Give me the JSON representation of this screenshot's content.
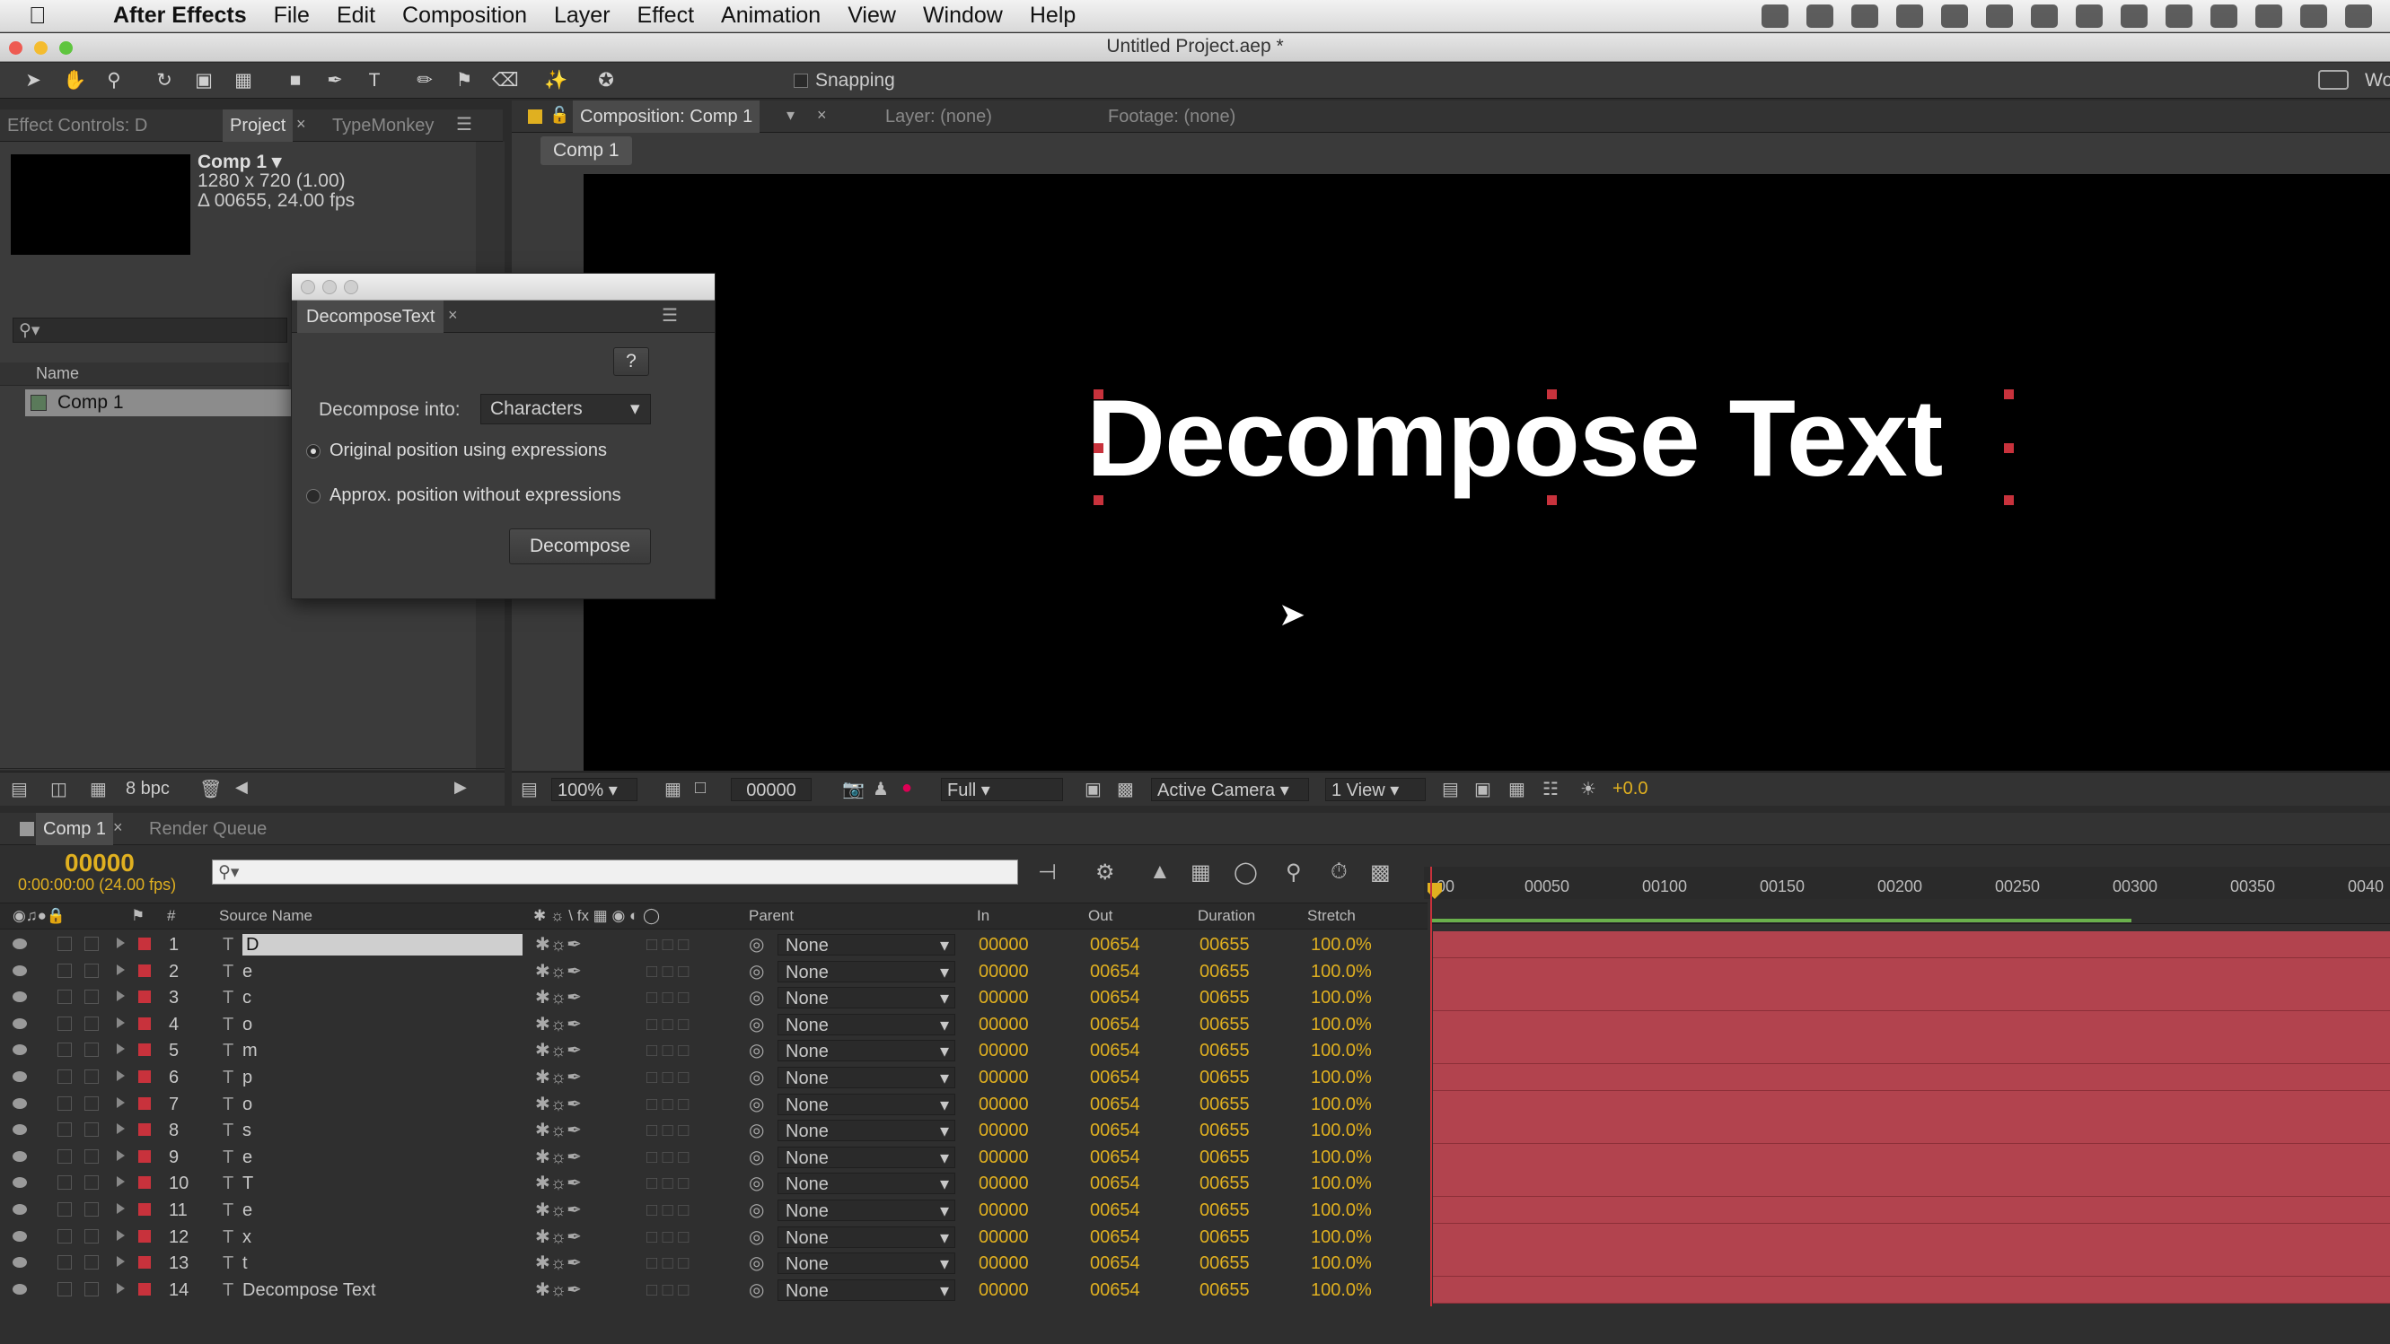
{
  "menubar": {
    "app_name": "After Effects",
    "items": [
      "File",
      "Edit",
      "Composition",
      "Layer",
      "Effect",
      "Animation",
      "View",
      "Window",
      "Help"
    ]
  },
  "window": {
    "title": "Untitled Project.aep *"
  },
  "toolbar": {
    "snapping_label": "Snapping",
    "workspace_partial": "Wo"
  },
  "project_panel": {
    "tabs": [
      "Effect Controls: D",
      "Project",
      "TypeMonkey"
    ],
    "comp_name": "Comp 1 ▾",
    "comp_size": "1280 x 720 (1.00)",
    "comp_duration": "Δ 00655, 24.00 fps",
    "name_header": "Name",
    "items": [
      "Comp 1"
    ],
    "bpc": "8 bpc"
  },
  "dialog": {
    "tab_title": "DecomposeText",
    "help_label": "?",
    "decompose_into_label": "Decompose into:",
    "decompose_into_value": "Characters",
    "option1": "Original position using expressions",
    "option2": "Approx. position without expressions",
    "decompose_button": "Decompose"
  },
  "viewer": {
    "tabs": [
      "Composition: Comp 1",
      "Layer: (none)",
      "Footage: (none)"
    ],
    "comp_tab": "Comp 1",
    "canvas_text": "Decompose Text",
    "zoom": "100%",
    "timecode": "00000",
    "resolution": "Full",
    "camera": "Active Camera",
    "views": "1 View",
    "exposure": "+0.0"
  },
  "timeline": {
    "tabs": [
      "Comp 1",
      "Render Queue"
    ],
    "current_time": "00000",
    "current_time_sub": "0:00:00:00 (24.00 fps)",
    "columns": {
      "num": "#",
      "source": "Source Name",
      "parent": "Parent",
      "in": "In",
      "out": "Out",
      "duration": "Duration",
      "stretch": "Stretch"
    },
    "ruler_ticks": [
      "00",
      "00050",
      "00100",
      "00150",
      "00200",
      "00250",
      "00300",
      "00350",
      "0040"
    ],
    "layers": [
      {
        "num": "1",
        "name": "D",
        "parent": "None",
        "in": "00000",
        "out": "00654",
        "duration": "00655",
        "stretch": "100.0%"
      },
      {
        "num": "2",
        "name": "e",
        "parent": "None",
        "in": "00000",
        "out": "00654",
        "duration": "00655",
        "stretch": "100.0%"
      },
      {
        "num": "3",
        "name": "c",
        "parent": "None",
        "in": "00000",
        "out": "00654",
        "duration": "00655",
        "stretch": "100.0%"
      },
      {
        "num": "4",
        "name": "o",
        "parent": "None",
        "in": "00000",
        "out": "00654",
        "duration": "00655",
        "stretch": "100.0%"
      },
      {
        "num": "5",
        "name": "m",
        "parent": "None",
        "in": "00000",
        "out": "00654",
        "duration": "00655",
        "stretch": "100.0%"
      },
      {
        "num": "6",
        "name": "p",
        "parent": "None",
        "in": "00000",
        "out": "00654",
        "duration": "00655",
        "stretch": "100.0%"
      },
      {
        "num": "7",
        "name": "o",
        "parent": "None",
        "in": "00000",
        "out": "00654",
        "duration": "00655",
        "stretch": "100.0%"
      },
      {
        "num": "8",
        "name": "s",
        "parent": "None",
        "in": "00000",
        "out": "00654",
        "duration": "00655",
        "stretch": "100.0%"
      },
      {
        "num": "9",
        "name": "e",
        "parent": "None",
        "in": "00000",
        "out": "00654",
        "duration": "00655",
        "stretch": "100.0%"
      },
      {
        "num": "10",
        "name": "T",
        "parent": "None",
        "in": "00000",
        "out": "00654",
        "duration": "00655",
        "stretch": "100.0%"
      },
      {
        "num": "11",
        "name": "e",
        "parent": "None",
        "in": "00000",
        "out": "00654",
        "duration": "00655",
        "stretch": "100.0%"
      },
      {
        "num": "12",
        "name": "x",
        "parent": "None",
        "in": "00000",
        "out": "00654",
        "duration": "00655",
        "stretch": "100.0%"
      },
      {
        "num": "13",
        "name": "t",
        "parent": "None",
        "in": "00000",
        "out": "00654",
        "duration": "00655",
        "stretch": "100.0%"
      },
      {
        "num": "14",
        "name": "Decompose Text",
        "parent": "None",
        "in": "00000",
        "out": "00654",
        "duration": "00655",
        "stretch": "100.0%"
      }
    ]
  },
  "colors": {
    "label_red": "#c8323c",
    "yellow": "#e0b020",
    "bar": "#b2434e"
  }
}
